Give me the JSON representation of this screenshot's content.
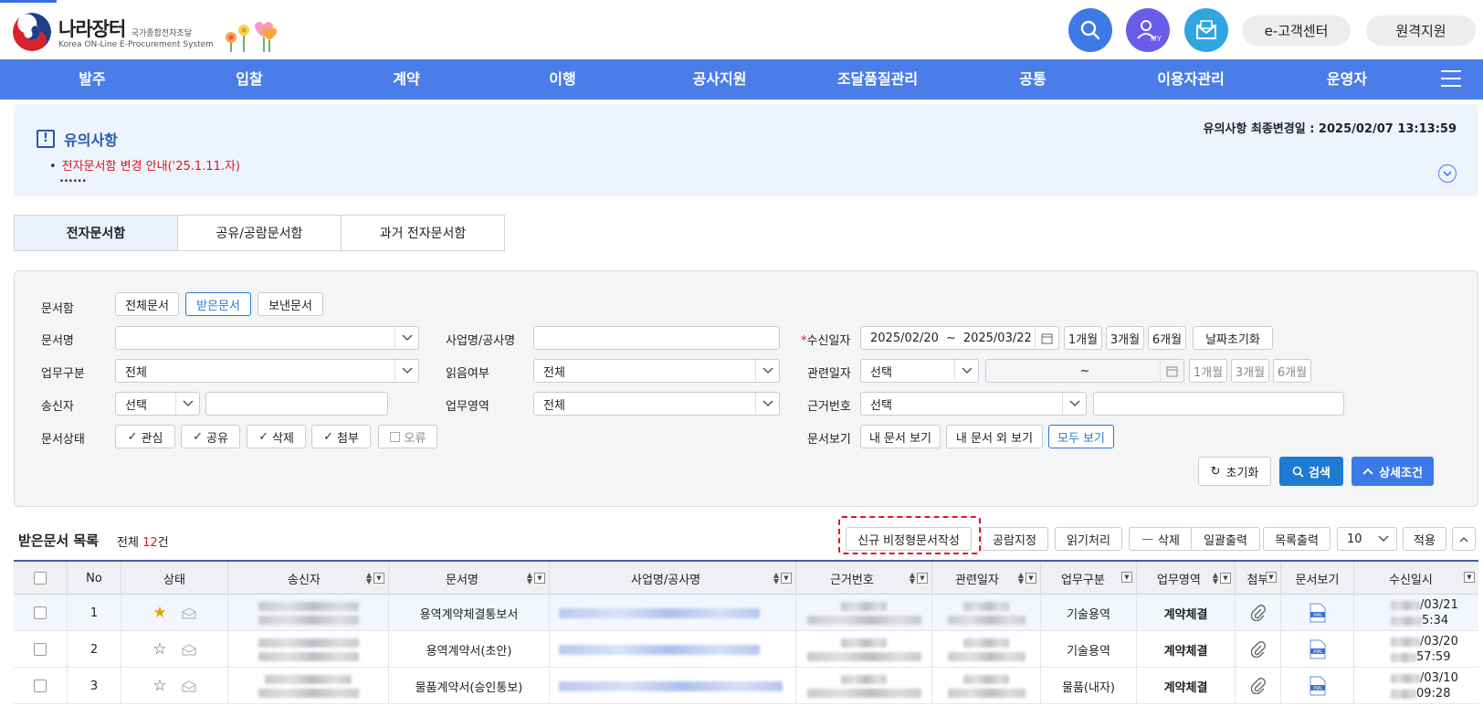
{
  "header": {
    "logo_title": "나라장터",
    "logo_sub": "국가종합전자조달",
    "logo_eng": "Korea ON-Line E-Procurement System",
    "customer_center": "e-고객센터",
    "remote_support": "원격지원",
    "my_label": "MY"
  },
  "gnb": [
    "발주",
    "입찰",
    "계약",
    "이행",
    "공사지원",
    "조달품질관리",
    "공통",
    "이용자관리",
    "운영자"
  ],
  "notice": {
    "title": "유의사항",
    "updated": "유의사항 최종변경일 : 2025/02/07 13:13:59",
    "item": "전자문서함 변경 안내('25.1.11.자)",
    "more": "......"
  },
  "tabs": [
    "전자문서함",
    "공유/공람문서함",
    "과거 전자문서함"
  ],
  "search": {
    "box_label": "문서함",
    "box_options": [
      "전체문서",
      "받은문서",
      "보낸문서"
    ],
    "doc_name_label": "문서명",
    "project_label": "사업명/공사명",
    "received_date_label": "수신일자",
    "date_from": "2025/02/20",
    "date_sep": "~",
    "date_to": "2025/03/22",
    "period_1m": "1개월",
    "period_3m": "3개월",
    "period_6m": "6개월",
    "date_reset": "날짜초기화",
    "biz_type_label": "업무구분",
    "biz_type_value": "전체",
    "read_label": "읽음여부",
    "read_value": "전체",
    "related_date_label": "관련일자",
    "related_date_value": "선택",
    "related_sep": "~",
    "sender_label": "송신자",
    "sender_value": "선택",
    "biz_area_label": "업무영역",
    "biz_area_value": "전체",
    "ref_no_label": "근거번호",
    "ref_no_value": "선택",
    "status_label": "문서상태",
    "status_options": [
      "관심",
      "공유",
      "삭제",
      "첨부",
      "오류"
    ],
    "view_label": "문서보기",
    "view_options": [
      "내 문서 보기",
      "내 문서 외 보기",
      "모두 보기"
    ],
    "reset": "초기화",
    "search": "검색",
    "detail": "상세조건"
  },
  "list": {
    "title": "받은문서 목록",
    "count_prefix": "전체 ",
    "count": "12",
    "count_suffix": "건",
    "actions": [
      "신규 비정형문서작성",
      "공람지정",
      "읽기처리",
      "삭제",
      "일괄출력",
      "목록출력"
    ],
    "page_size": "10",
    "apply": "적용",
    "columns": [
      "No",
      "상태",
      "송신자",
      "문서명",
      "사업명/공사명",
      "근거번호",
      "관련일자",
      "업무구분",
      "업무영역",
      "첨부",
      "문서보기",
      "수신일시"
    ],
    "rows": [
      {
        "no": "1",
        "doc": "용역계약체결통보서",
        "biz_type": "기술용역",
        "biz_area": "계약체결",
        "date": "/03/21",
        "time": "5:34"
      },
      {
        "no": "2",
        "doc": "용역계약서(초안)",
        "biz_type": "기술용역",
        "biz_area": "계약체결",
        "date": "/03/20",
        "time": "57:59"
      },
      {
        "no": "3",
        "doc": "물품계약서(승인통보)",
        "biz_type": "물품(내자)",
        "biz_area": "계약체결",
        "date": "/03/10",
        "time": "09:28"
      }
    ]
  }
}
